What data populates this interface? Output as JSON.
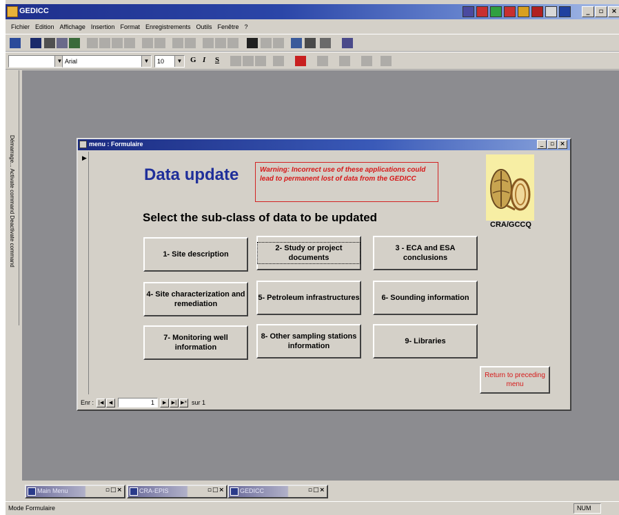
{
  "app": {
    "title": "GEDICC"
  },
  "colors": {
    "titlebar": "#1f2f8c",
    "heading": "#1f2f9a",
    "warning": "#d61818",
    "desktop": "#8c8c90"
  },
  "menubar": [
    "Fichier",
    "Edition",
    "Affichage",
    "Insertion",
    "Format",
    "Enregistrements",
    "Outils",
    "Fenêtre",
    "?"
  ],
  "format_toolbar": {
    "font_name": "Arial",
    "font_size": "10",
    "bold": "G",
    "italic": "I",
    "underline": "S"
  },
  "side_panel": {
    "text": "Démarrage...   Activate command   Deactivate command"
  },
  "form": {
    "window_title": "menu : Formulaire",
    "heading": "Data update",
    "warning": "Warning: Incorrect use of these applications could lead to permanent lost of data from the GEDICC",
    "subtitle": "Select the sub-class of data to be updated",
    "logo_caption": "CRA/GCCQ",
    "buttons": [
      "1- Site description",
      "2- Study or project documents",
      "3 - ECA and ESA conclusions",
      "4- Site characterization and remediation",
      "5- Petroleum infrastructures",
      "6- Sounding information",
      "7- Monitoring well information",
      "8- Other sampling stations information",
      "9- Libraries"
    ],
    "return_button": "Return to preceding menu",
    "navigation": {
      "label": "Enr :",
      "record": "1",
      "of_label": "sur 1"
    }
  },
  "minimized_windows": [
    "Main Menu",
    "CRA-EPIS",
    "GEDICC"
  ],
  "statusbar": {
    "mode": "Mode Formulaire",
    "num": "NUM"
  }
}
